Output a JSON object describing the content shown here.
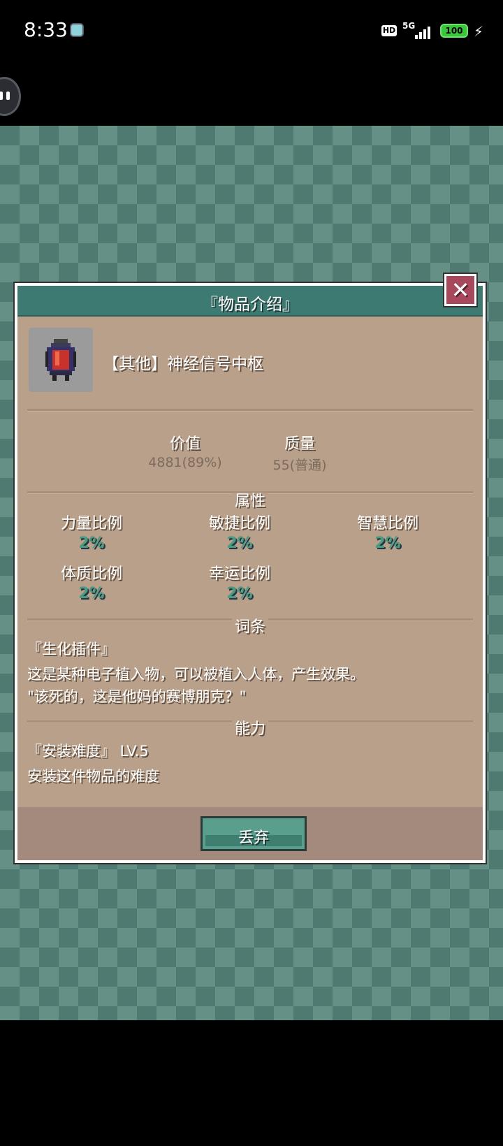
{
  "status_bar": {
    "time": "8:33",
    "hd": "HD",
    "network": "5G",
    "battery": "100"
  },
  "dialog": {
    "title": "『物品介绍』",
    "close_label": "✕",
    "item": {
      "icon": "cyber-implant-canister-icon",
      "name": "【其他】神经信号中枢"
    },
    "stats": {
      "value_label": "价值",
      "value": "4881(89%)",
      "quality_label": "质量",
      "quality": "55(普通)"
    },
    "attributes_title": "属性",
    "attributes": [
      {
        "label": "力量比例",
        "value": "2%"
      },
      {
        "label": "敏捷比例",
        "value": "2%"
      },
      {
        "label": "智慧比例",
        "value": "2%"
      },
      {
        "label": "体质比例",
        "value": "2%"
      },
      {
        "label": "幸运比例",
        "value": "2%"
      }
    ],
    "entry_title": "词条",
    "entry": {
      "name": "『生化插件』",
      "desc1": "这是某种电子植入物，可以被植入人体，产生效果。",
      "desc2": "\"该死的，这是他妈的赛博朋克？\""
    },
    "ability_title": "能力",
    "ability": {
      "name": "『安装难度』 LV.5",
      "desc": "安装这件物品的难度"
    },
    "discard_label": "丢弃"
  }
}
